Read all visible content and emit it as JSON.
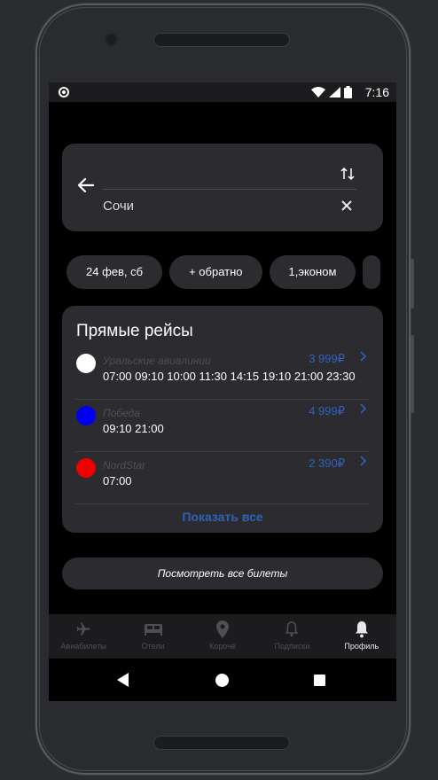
{
  "status": {
    "time": "7:16"
  },
  "search": {
    "from_value": "",
    "to_value": "Сочи"
  },
  "chips": [
    "24 фев, сб",
    "+ обратно",
    "1,эконом"
  ],
  "direct": {
    "title": "Прямые рейсы",
    "flights": [
      {
        "airline": "Уральские авиалинии",
        "times": "07:00 09:10 10:00 11:30 14:15 19:10 21:00 23:30",
        "price": "3 999₽",
        "color": "#ffffff"
      },
      {
        "airline": "Победа",
        "times": "09:10 21:00",
        "price": "4 999₽",
        "color": "#0000ee"
      },
      {
        "airline": "NordStar",
        "times": "07:00",
        "price": "2 390₽",
        "color": "#ee0000"
      }
    ],
    "show_all": "Показать все"
  },
  "view_all_tickets": "Посмотреть все билеты",
  "tabs": [
    {
      "label": "Авиабилеты",
      "icon": "plane-icon",
      "active": false
    },
    {
      "label": "Отели",
      "icon": "bed-icon",
      "active": false
    },
    {
      "label": "Короче",
      "icon": "location-pin-icon",
      "active": false
    },
    {
      "label": "Подписки",
      "icon": "bell-outline-icon",
      "active": false
    },
    {
      "label": "Профиль",
      "icon": "bell-icon",
      "active": true
    }
  ],
  "colors": {
    "accent": "#2f62b7",
    "card": "#2c2c30",
    "inactive_tab": "#4e4e53"
  }
}
